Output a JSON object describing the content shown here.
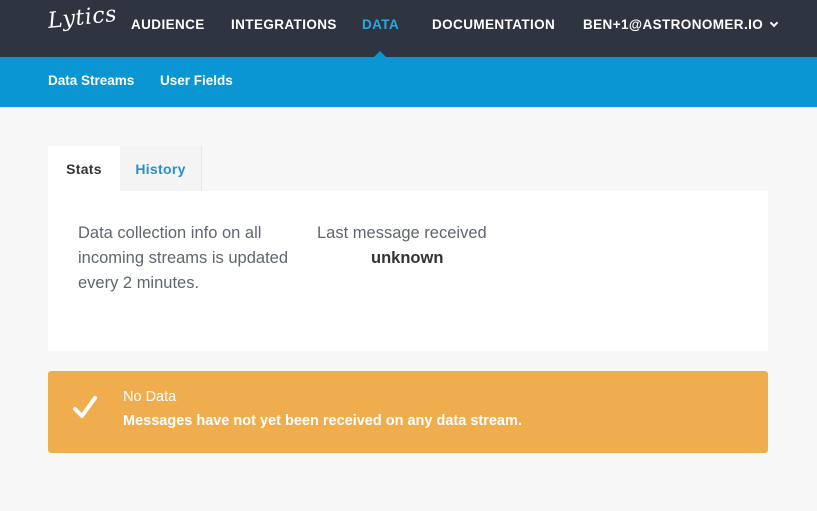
{
  "brand": {
    "logo_text": "Lytics"
  },
  "nav": {
    "items": [
      {
        "label": "AUDIENCE"
      },
      {
        "label": "INTEGRATIONS"
      },
      {
        "label": "DATA"
      },
      {
        "label": "DOCUMENTATION"
      }
    ],
    "active": "DATA",
    "user": "BEN+1@ASTRONOMER.IO"
  },
  "subnav": {
    "items": [
      {
        "label": "Data Streams"
      },
      {
        "label": "User Fields"
      }
    ]
  },
  "tabs": [
    {
      "label": "Stats"
    },
    {
      "label": "History"
    }
  ],
  "stats": {
    "info": "Data collection info on all incoming streams is updated every 2 minutes.",
    "last_message_label": "Last message received",
    "last_message_value": "unknown"
  },
  "alert": {
    "title": "No Data",
    "message": "Messages have not yet been received on any data stream.",
    "color": "#f0ad4e",
    "icon": "check-icon"
  },
  "colors": {
    "topnav": "#2f3540",
    "subnav": "#0996d3",
    "active_nav": "#2aa8e0"
  }
}
